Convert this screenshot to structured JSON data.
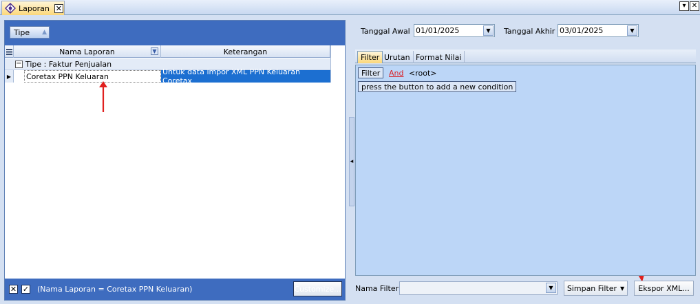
{
  "tab": {
    "title": "Laporan",
    "close_glyph": "✕"
  },
  "window_controls": {
    "dropdown_glyph": "▾",
    "close_glyph": "✕"
  },
  "left": {
    "group_chip": {
      "label": "Tipe"
    },
    "columns": [
      "Nama Laporan",
      "Keterangan"
    ],
    "group_row": {
      "label": "Tipe : Faktur Penjualan",
      "toggle": "−"
    },
    "rows": [
      {
        "nama": "Coretax PPN Keluaran",
        "keterangan": "Untuk data impor XML PPN Keluaran Coretax"
      }
    ],
    "filter_bar": {
      "text": "(Nama Laporan = Coretax PPN Keluaran)",
      "close_glyph": "✕",
      "check_glyph": "✓",
      "customize_label": "Customize..."
    }
  },
  "right": {
    "tanggal_awal": {
      "label": "Tanggal Awal",
      "value": "01/01/2025"
    },
    "tanggal_akhir": {
      "label": "Tanggal Akhir",
      "value": "03/01/2025"
    },
    "tabs": [
      "Filter",
      "Urutan",
      "Format Nilai"
    ],
    "filter_editor": {
      "filter_button": "Filter",
      "operator": "And",
      "root": "<root>",
      "hint": "press the button to add a new condition"
    },
    "nama_filter": {
      "label": "Nama Filter",
      "value": ""
    },
    "simpan_filter_label": "Simpan Filter",
    "ekspor_label": "Ekspor XML..."
  },
  "colors": {
    "panel_blue": "#3e6cbf",
    "selection": "#1c6fd1",
    "filter_editor_bg": "#bcd6f7",
    "annotation_arrow": "#e0201e"
  }
}
